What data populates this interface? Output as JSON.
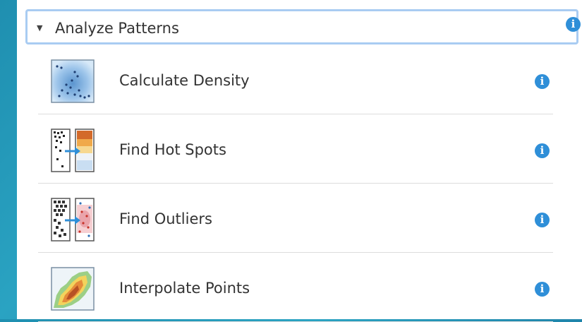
{
  "panel": {
    "section": {
      "title": "Analyze Patterns",
      "caret_icon": "caret-down-icon",
      "info_icon": "info-icon",
      "info_glyph": "i"
    },
    "tools": [
      {
        "label": "Calculate Density",
        "thumbnail": "density-thumbnail",
        "info_glyph": "i"
      },
      {
        "label": "Find Hot Spots",
        "thumbnail": "hot-spots-thumbnail",
        "info_glyph": "i"
      },
      {
        "label": "Find Outliers",
        "thumbnail": "outliers-thumbnail",
        "info_glyph": "i"
      },
      {
        "label": "Interpolate Points",
        "thumbnail": "interpolate-thumbnail",
        "info_glyph": "i"
      }
    ]
  },
  "colors": {
    "info_blue": "#2f8fd8",
    "header_border": "#a9ccf2",
    "background_teal": "#1f8fb0"
  }
}
